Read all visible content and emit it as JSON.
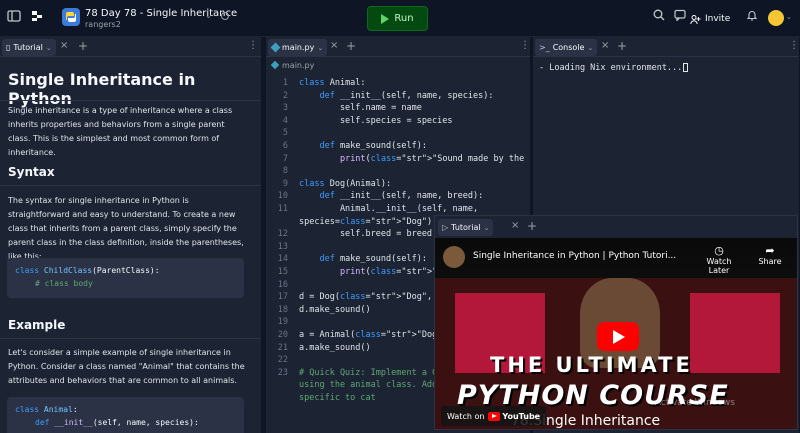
{
  "topbar": {
    "repl_title": "78 Day 78 - Single Inheritance",
    "repl_owner": "rangers2",
    "run_label": "Run",
    "invite_label": "Invite"
  },
  "tutorial": {
    "tab_label": "Tutorial",
    "h1": "Single Inheritance in Python",
    "intro": "Single inheritance is a type of inheritance where a class inherits properties and behaviors from a single parent class. This is the simplest and most common form of inheritance.",
    "syntax_heading": "Syntax",
    "syntax_text": "The syntax for single inheritance in Python is straightforward and easy to understand. To create a new class that inherits from a parent class, simply specify the parent class in the class definition, inside the parentheses, like this:",
    "syntax_code": {
      "line1_kw": "class",
      "line1_cls": "ChildClass",
      "line1_rest": "(ParentClass):",
      "line2": "# class body"
    },
    "example_heading": "Example",
    "example_text": "Let's consider a simple example of single inheritance in Python. Consider a class named \"Animal\" that contains the attributes and behaviors that are common to all animals.",
    "example_code": {
      "line1_kw": "class",
      "line1_cls": "Animal",
      "line1_rest": ":",
      "line2_kw": "def",
      "line2_fn": "__init__",
      "line2_rest": "(self, name, species):"
    }
  },
  "editor": {
    "tab_label": "main.py",
    "breadcrumb": "main.py",
    "lines": [
      {
        "n": "1",
        "t": "class Animal:"
      },
      {
        "n": "2",
        "t": "    def __init__(self, name, species):"
      },
      {
        "n": "3",
        "t": "        self.name = name"
      },
      {
        "n": "4",
        "t": "        self.species = species"
      },
      {
        "n": "5",
        "t": ""
      },
      {
        "n": "6",
        "t": "    def make_sound(self):"
      },
      {
        "n": "7",
        "t": "        print(\"Sound made by the animal\")"
      },
      {
        "n": "8",
        "t": ""
      },
      {
        "n": "9",
        "t": "class Dog(Animal):"
      },
      {
        "n": "10",
        "t": "    def __init__(self, name, breed):"
      },
      {
        "n": "11",
        "t": "        Animal.__init__(self, name,"
      },
      {
        "n": "",
        "t": "species=\"Dog\")"
      },
      {
        "n": "12",
        "t": "        self.breed = breed"
      },
      {
        "n": "13",
        "t": ""
      },
      {
        "n": "14",
        "t": "    def make_sound(self):"
      },
      {
        "n": "15",
        "t": "        print(\"Bark!\")"
      },
      {
        "n": "16",
        "t": ""
      },
      {
        "n": "17",
        "t": "d = Dog(\"Dog\", \"Doggerman\")"
      },
      {
        "n": "18",
        "t": "d.make_sound()"
      },
      {
        "n": "19",
        "t": ""
      },
      {
        "n": "20",
        "t": "a = Animal(\"Dog\", \"Dog\")"
      },
      {
        "n": "21",
        "t": "a.make_sound()"
      },
      {
        "n": "22",
        "t": ""
      },
      {
        "n": "23",
        "t": "# Quick Quiz: Implement a C"
      },
      {
        "n": "",
        "t": "using the animal class. Add"
      },
      {
        "n": "",
        "t": "specific to cat"
      }
    ]
  },
  "console": {
    "tab_label": "Console",
    "output": "- Loading Nix environment..."
  },
  "video": {
    "tab_label": "Tutorial",
    "title": "Single Inheritance in Python | Python Tutori...",
    "watch_later": "Watch Later",
    "share": "Share",
    "thumb_line1": "THE ULTIMATE",
    "thumb_line2": "PYTHON COURSE",
    "thumb_line3": "78.Single Inheritance",
    "watch_on": "Watch on",
    "youtube": "YouTube",
    "watermark": "Activate Windows"
  },
  "icons": {
    "sidebar": "sidebar-toggle-icon",
    "logo": "replit-logo-icon",
    "search": "search-icon",
    "chat": "chat-icon",
    "bell": "bell-icon"
  }
}
